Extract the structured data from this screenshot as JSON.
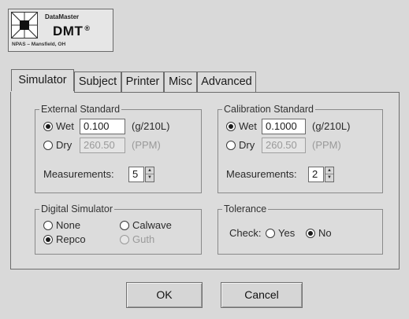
{
  "logo": {
    "brand": "DataMaster",
    "model": "DMT",
    "registered": "®",
    "location": "NPAS – Mansfield, OH"
  },
  "tabs": [
    {
      "label": "Simulator",
      "active": true
    },
    {
      "label": "Subject",
      "active": false
    },
    {
      "label": "Printer",
      "active": false
    },
    {
      "label": "Misc",
      "active": false
    },
    {
      "label": "Advanced",
      "active": false
    }
  ],
  "external_standard": {
    "title": "External Standard",
    "wet": {
      "label": "Wet",
      "value": "0.100",
      "unit": "(g/210L)",
      "selected": true
    },
    "dry": {
      "label": "Dry",
      "value": "260.50",
      "unit": "(PPM)",
      "selected": false
    },
    "measurements": {
      "label": "Measurements:",
      "value": "5"
    }
  },
  "calibration_standard": {
    "title": "Calibration Standard",
    "wet": {
      "label": "Wet",
      "value": "0.1000",
      "unit": "(g/210L)",
      "selected": true
    },
    "dry": {
      "label": "Dry",
      "value": "260.50",
      "unit": "(PPM)",
      "selected": false
    },
    "measurements": {
      "label": "Measurements:",
      "value": "2"
    }
  },
  "digital_simulator": {
    "title": "Digital Simulator",
    "options": [
      {
        "label": "None",
        "selected": false,
        "enabled": true
      },
      {
        "label": "Calwave",
        "selected": false,
        "enabled": true
      },
      {
        "label": "Repco",
        "selected": true,
        "enabled": true
      },
      {
        "label": "Guth",
        "selected": false,
        "enabled": false
      }
    ]
  },
  "tolerance": {
    "title": "Tolerance",
    "check_label": "Check:",
    "yes": {
      "label": "Yes",
      "selected": false
    },
    "no": {
      "label": "No",
      "selected": true
    }
  },
  "buttons": {
    "ok": "OK",
    "cancel": "Cancel"
  },
  "colors": {
    "window_bg": "#d9d9d9",
    "panel_bg": "#dcdcdc",
    "disabled_text": "#9a9a9a"
  }
}
